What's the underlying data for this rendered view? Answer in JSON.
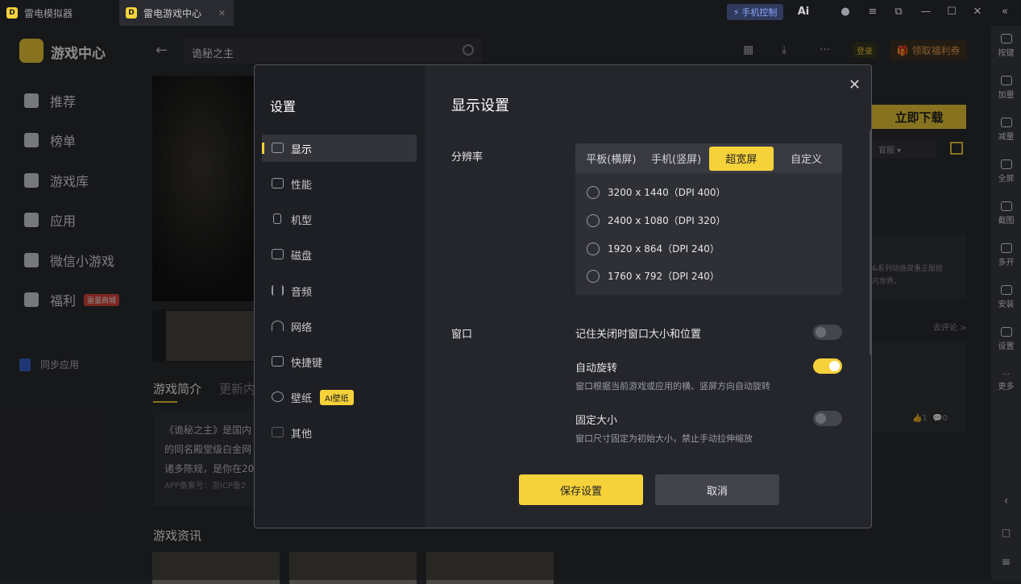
{
  "titlebar": {
    "tab1": "雷电模拟器",
    "tab2": "雷电游戏中心",
    "phone_control": "手机控制",
    "ai_label": "Ai"
  },
  "left_nav": {
    "logo_title": "游戏中心",
    "items": [
      {
        "label": "推荐"
      },
      {
        "label": "榜单"
      },
      {
        "label": "游戏库"
      },
      {
        "label": "应用"
      },
      {
        "label": "微信小游戏"
      },
      {
        "label": "福利",
        "badge": "雷量商城"
      }
    ],
    "sync_label": "同步应用"
  },
  "header": {
    "search_value": "诡秘之主",
    "login": "登录",
    "welfare": "领取福利券"
  },
  "right_bar": [
    {
      "label": "按键"
    },
    {
      "label": "加量"
    },
    {
      "label": "减量"
    },
    {
      "label": "全屏"
    },
    {
      "label": "截图"
    },
    {
      "label": "多开"
    },
    {
      "label": "安装"
    },
    {
      "label": "设置"
    },
    {
      "label": "更多"
    }
  ],
  "game_page": {
    "download": "立即下载",
    "official": "官服",
    "card_text1": "&系列动画双重正版授",
    "card_text2": "凡世界。",
    "comment_link": "去评论 >",
    "likes": "1",
    "comments": "0",
    "tab_intro": "游戏简介",
    "tab_update": "更新内",
    "intro_line1": "《诡秘之主》是国内",
    "intro_line2": "的同名殿堂级白金网",
    "intro_line3": "诸多陈规，是你在20",
    "intro_record": "APP备案号：浙ICP备2",
    "news_title": "游戏资讯"
  },
  "settings": {
    "title": "设置",
    "menu": [
      {
        "label": "显示",
        "icon": "monitor-icon",
        "active": true
      },
      {
        "label": "性能",
        "icon": "performance-icon"
      },
      {
        "label": "机型",
        "icon": "phone-icon"
      },
      {
        "label": "磁盘",
        "icon": "disk-icon"
      },
      {
        "label": "音频",
        "icon": "audio-icon"
      },
      {
        "label": "网络",
        "icon": "wifi-icon"
      },
      {
        "label": "快捷键",
        "icon": "keyboard-icon"
      },
      {
        "label": "壁纸",
        "icon": "palette-icon",
        "badge": "AI壁纸"
      },
      {
        "label": "其他",
        "icon": "grid-icon"
      }
    ],
    "display_title": "显示设置",
    "resolution_label": "分辨率",
    "segments": [
      {
        "label": "平板(横屏)"
      },
      {
        "label": "手机(竖屏)"
      },
      {
        "label": "超宽屏",
        "active": true
      },
      {
        "label": "自定义"
      }
    ],
    "resolutions": [
      "3200 x 1440（DPI 400）",
      "2400 x 1080（DPI 320）",
      "1920 x 864（DPI 240）",
      "1760 x 792（DPI 240）"
    ],
    "window_label": "窗口",
    "options": [
      {
        "label": "记住关闭时窗口大小和位置",
        "desc": "",
        "on": false
      },
      {
        "label": "自动旋转",
        "desc": "窗口根据当前游戏或应用的横、竖屏方向自动旋转",
        "on": true
      },
      {
        "label": "固定大小",
        "desc": "窗口尺寸固定为初始大小，禁止手动拉伸缩放",
        "on": false
      }
    ],
    "save": "保存设置",
    "cancel": "取消"
  },
  "colors": {
    "accent": "#f6d23a",
    "panel": "#25262c"
  }
}
